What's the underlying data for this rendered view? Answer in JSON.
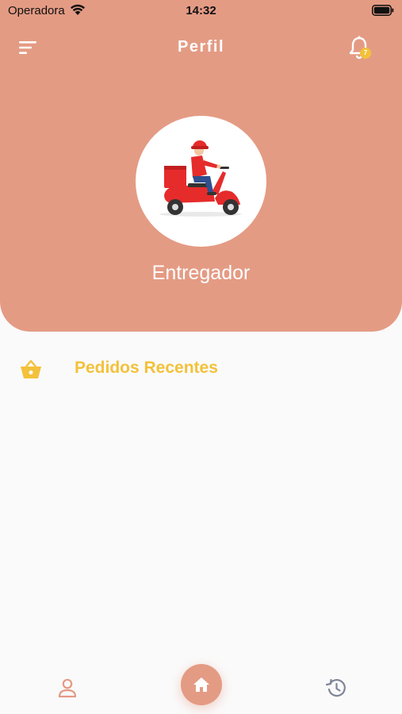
{
  "status_bar": {
    "carrier": "Operadora",
    "time": "14:32"
  },
  "header": {
    "title": "Perfil",
    "menu_icon": "menu-icon",
    "notification_icon": "bell-icon",
    "notification_badge": "7"
  },
  "profile": {
    "role": "Entregador",
    "avatar_icon": "delivery-scooter-illustration"
  },
  "recent_orders": {
    "title": "Pedidos Recentes",
    "icon": "basket-icon",
    "items": []
  },
  "bottom_nav": {
    "items": [
      {
        "icon": "person-icon"
      },
      {
        "icon": "home-icon",
        "active": true
      },
      {
        "icon": "history-icon"
      }
    ]
  },
  "colors": {
    "primary": "#e49b84",
    "accent": "#f3c13a",
    "background": "#fafafa",
    "nav_inactive": "#7d8597"
  }
}
